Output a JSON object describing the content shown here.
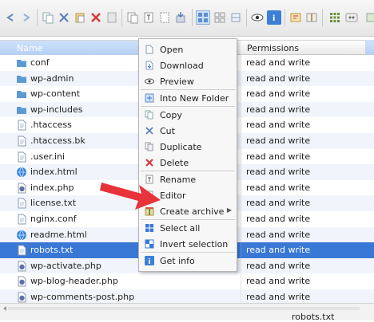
{
  "header": {
    "name_label": "Name",
    "permissions_label": "Permissions"
  },
  "files": [
    {
      "name": "conf",
      "type": "folder",
      "permissions": "read and write"
    },
    {
      "name": "wp-admin",
      "type": "folder",
      "permissions": "read and write"
    },
    {
      "name": "wp-content",
      "type": "folder",
      "permissions": "read and write"
    },
    {
      "name": "wp-includes",
      "type": "folder",
      "permissions": "read and write"
    },
    {
      "name": ".htaccess",
      "type": "file",
      "permissions": "read and write"
    },
    {
      "name": ".htaccess.bk",
      "type": "file",
      "permissions": "read and write"
    },
    {
      "name": ".user.ini",
      "type": "file",
      "permissions": "read and write"
    },
    {
      "name": "index.html",
      "type": "html",
      "permissions": "read and write"
    },
    {
      "name": "index.php",
      "type": "php",
      "permissions": "read and write"
    },
    {
      "name": "license.txt",
      "type": "file",
      "permissions": "read and write"
    },
    {
      "name": "nginx.conf",
      "type": "file",
      "permissions": "read and write"
    },
    {
      "name": "readme.html",
      "type": "html",
      "permissions": "read and write"
    },
    {
      "name": "robots.txt",
      "type": "file",
      "permissions": "read and write",
      "selected": true
    },
    {
      "name": "wp-activate.php",
      "type": "php",
      "permissions": "read and write"
    },
    {
      "name": "wp-blog-header.php",
      "type": "php",
      "permissions": "read and write"
    },
    {
      "name": "wp-comments-post.php",
      "type": "php",
      "permissions": "read and write"
    }
  ],
  "context_menu": {
    "items": [
      {
        "label": "Open",
        "icon": "open-icon"
      },
      {
        "label": "Download",
        "icon": "download-icon"
      },
      {
        "label": "Preview",
        "icon": "eye-icon"
      },
      {
        "label": "Into New Folder",
        "icon": "new-folder-icon"
      },
      {
        "label": "Copy",
        "icon": "copy-icon"
      },
      {
        "label": "Cut",
        "icon": "scissors-icon"
      },
      {
        "label": "Duplicate",
        "icon": "duplicate-icon"
      },
      {
        "label": "Delete",
        "icon": "delete-icon"
      },
      {
        "label": "Rename",
        "icon": "rename-icon"
      },
      {
        "label": "Editor",
        "icon": "editor-icon"
      },
      {
        "label": "Create archive",
        "icon": "archive-icon"
      },
      {
        "label": "Select all",
        "icon": "select-all-icon"
      },
      {
        "label": "Invert selection",
        "icon": "invert-selection-icon"
      },
      {
        "label": "Get info",
        "icon": "info-icon"
      }
    ]
  },
  "status": {
    "selected_file": "robots.txt"
  },
  "colors": {
    "selection": "#3a78d6",
    "arrow": "#e8333a",
    "folder": "#5b9bd5"
  }
}
